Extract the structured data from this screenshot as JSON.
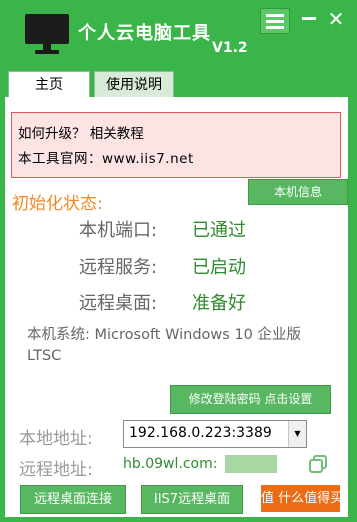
{
  "app": {
    "title": "个人云电脑工具",
    "version": "V1.2",
    "colors": {
      "primary": "#3bb54a",
      "accent": "#f08a28",
      "ok": "#2e8b2e",
      "alert_bg": "#fde4e4",
      "alert_border": "#e05a5a"
    }
  },
  "window_controls": {
    "menu_icon": "hamburger-menu-icon",
    "minimize_icon": "minimize-icon",
    "close_label": "✕"
  },
  "tabs": [
    {
      "label": "主页",
      "active": true
    },
    {
      "label": "使用说明",
      "active": false
    }
  ],
  "notice": {
    "line1": "如何升级？ 相关教程",
    "line2": "本工具官网：www.iis7.net"
  },
  "init": {
    "title": "初始化状态:",
    "info_button": "本机信息",
    "rows": [
      {
        "label": "本机端口:",
        "value": "已通过"
      },
      {
        "label": "远程服务:",
        "value": "已启动"
      },
      {
        "label": "远程桌面:",
        "value": "准备好"
      }
    ]
  },
  "system": {
    "text": "本机系统: Microsoft Windows 10 企业版 LTSC"
  },
  "password_button": "修改登陆密码 点击设置",
  "address": {
    "local_label": "本地地址:",
    "local_value": "192.168.0.223:3389",
    "remote_label": "远程地址:",
    "remote_value": "hb.09wl.com:",
    "copy_icon": "copy-icon"
  },
  "buttons": {
    "connect": "远程桌面连接",
    "iis7": "IIS7远程桌面",
    "orange": "值 什么值得买"
  }
}
